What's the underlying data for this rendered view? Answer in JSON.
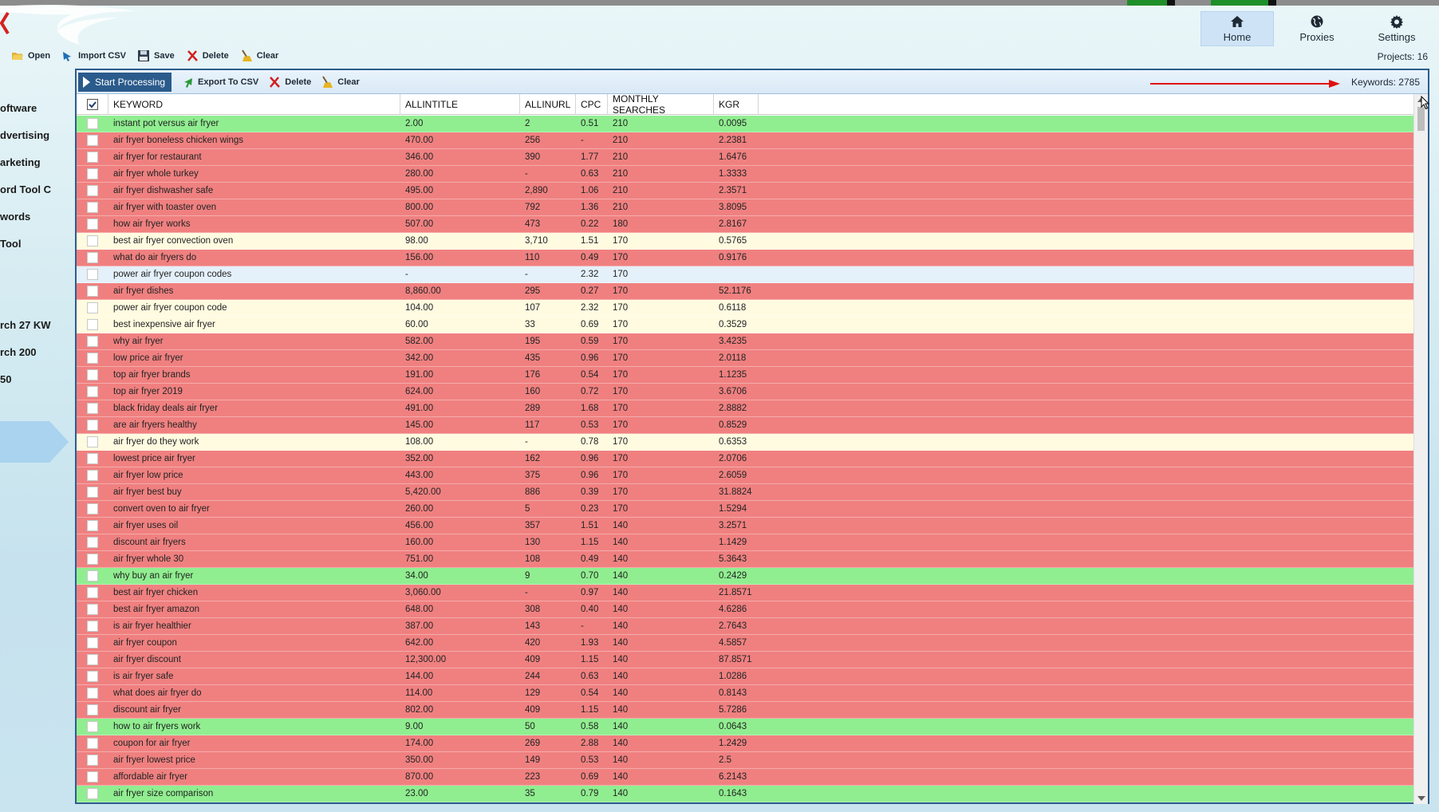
{
  "nav": {
    "home_label": "Home",
    "proxies_label": "Proxies",
    "settings_label": "Settings",
    "projects_text": "Projects: 16"
  },
  "toolbar": {
    "open_label": "Open",
    "import_label": "Import CSV",
    "save_label": "Save",
    "delete_label": "Delete",
    "clear_label": "Clear"
  },
  "sidebar": {
    "items": [
      "oftware",
      "dvertising",
      "arketing",
      "ord Tool C",
      "words",
      "Tool",
      "rch 27 KW",
      "rch 200",
      "50"
    ]
  },
  "panel": {
    "start_label": "Start Processing",
    "export_label": "Export To CSV",
    "delete_label": "Delete",
    "clear_label": "Clear",
    "keywords_text": "Keywords: 2785"
  },
  "table": {
    "columns": [
      "KEYWORD",
      "ALLINTITLE",
      "ALLINURL",
      "CPC",
      "MONTHLY SEARCHES",
      "KGR"
    ],
    "rows": [
      {
        "kw": "instant pot versus air fryer",
        "at": "2.00",
        "au": "2",
        "cpc": "0.51",
        "ms": "210",
        "kgr": "0.0095",
        "color": "green"
      },
      {
        "kw": "air fryer boneless chicken wings",
        "at": "470.00",
        "au": "256",
        "cpc": "-",
        "ms": "210",
        "kgr": "2.2381",
        "color": "red"
      },
      {
        "kw": "air fryer for restaurant",
        "at": "346.00",
        "au": "390",
        "cpc": "1.77",
        "ms": "210",
        "kgr": "1.6476",
        "color": "red"
      },
      {
        "kw": "air fryer whole turkey",
        "at": "280.00",
        "au": "-",
        "cpc": "0.63",
        "ms": "210",
        "kgr": "1.3333",
        "color": "red"
      },
      {
        "kw": "air fryer dishwasher safe",
        "at": "495.00",
        "au": "2,890",
        "cpc": "1.06",
        "ms": "210",
        "kgr": "2.3571",
        "color": "red"
      },
      {
        "kw": "air fryer with toaster oven",
        "at": "800.00",
        "au": "792",
        "cpc": "1.36",
        "ms": "210",
        "kgr": "3.8095",
        "color": "red"
      },
      {
        "kw": "how air fryer works",
        "at": "507.00",
        "au": "473",
        "cpc": "0.22",
        "ms": "180",
        "kgr": "2.8167",
        "color": "red"
      },
      {
        "kw": "best air fryer convection oven",
        "at": "98.00",
        "au": "3,710",
        "cpc": "1.51",
        "ms": "170",
        "kgr": "0.5765",
        "color": "yellow"
      },
      {
        "kw": "what do air fryers do",
        "at": "156.00",
        "au": "110",
        "cpc": "0.49",
        "ms": "170",
        "kgr": "0.9176",
        "color": "red"
      },
      {
        "kw": "power air fryer coupon codes",
        "at": "-",
        "au": "-",
        "cpc": "2.32",
        "ms": "170",
        "kgr": "",
        "color": "blue"
      },
      {
        "kw": "air fryer dishes",
        "at": "8,860.00",
        "au": "295",
        "cpc": "0.27",
        "ms": "170",
        "kgr": "52.1176",
        "color": "red"
      },
      {
        "kw": "power air fryer coupon code",
        "at": "104.00",
        "au": "107",
        "cpc": "2.32",
        "ms": "170",
        "kgr": "0.6118",
        "color": "yellow"
      },
      {
        "kw": "best inexpensive air fryer",
        "at": "60.00",
        "au": "33",
        "cpc": "0.69",
        "ms": "170",
        "kgr": "0.3529",
        "color": "yellow"
      },
      {
        "kw": "why air fryer",
        "at": "582.00",
        "au": "195",
        "cpc": "0.59",
        "ms": "170",
        "kgr": "3.4235",
        "color": "red"
      },
      {
        "kw": "low price air fryer",
        "at": "342.00",
        "au": "435",
        "cpc": "0.96",
        "ms": "170",
        "kgr": "2.0118",
        "color": "red"
      },
      {
        "kw": "top air fryer brands",
        "at": "191.00",
        "au": "176",
        "cpc": "0.54",
        "ms": "170",
        "kgr": "1.1235",
        "color": "red"
      },
      {
        "kw": "top air fryer 2019",
        "at": "624.00",
        "au": "160",
        "cpc": "0.72",
        "ms": "170",
        "kgr": "3.6706",
        "color": "red"
      },
      {
        "kw": "black friday deals air fryer",
        "at": "491.00",
        "au": "289",
        "cpc": "1.68",
        "ms": "170",
        "kgr": "2.8882",
        "color": "red"
      },
      {
        "kw": "are air fryers healthy",
        "at": "145.00",
        "au": "117",
        "cpc": "0.53",
        "ms": "170",
        "kgr": "0.8529",
        "color": "red"
      },
      {
        "kw": "air fryer do they work",
        "at": "108.00",
        "au": "-",
        "cpc": "0.78",
        "ms": "170",
        "kgr": "0.6353",
        "color": "yellow"
      },
      {
        "kw": "lowest price air fryer",
        "at": "352.00",
        "au": "162",
        "cpc": "0.96",
        "ms": "170",
        "kgr": "2.0706",
        "color": "red"
      },
      {
        "kw": "air fryer low price",
        "at": "443.00",
        "au": "375",
        "cpc": "0.96",
        "ms": "170",
        "kgr": "2.6059",
        "color": "red"
      },
      {
        "kw": "air fryer best buy",
        "at": "5,420.00",
        "au": "886",
        "cpc": "0.39",
        "ms": "170",
        "kgr": "31.8824",
        "color": "red"
      },
      {
        "kw": "convert oven to air fryer",
        "at": "260.00",
        "au": "5",
        "cpc": "0.23",
        "ms": "170",
        "kgr": "1.5294",
        "color": "red"
      },
      {
        "kw": "air fryer uses oil",
        "at": "456.00",
        "au": "357",
        "cpc": "1.51",
        "ms": "140",
        "kgr": "3.2571",
        "color": "red"
      },
      {
        "kw": "discount air fryers",
        "at": "160.00",
        "au": "130",
        "cpc": "1.15",
        "ms": "140",
        "kgr": "1.1429",
        "color": "red"
      },
      {
        "kw": "air fryer whole 30",
        "at": "751.00",
        "au": "108",
        "cpc": "0.49",
        "ms": "140",
        "kgr": "5.3643",
        "color": "red"
      },
      {
        "kw": "why buy an air fryer",
        "at": "34.00",
        "au": "9",
        "cpc": "0.70",
        "ms": "140",
        "kgr": "0.2429",
        "color": "green"
      },
      {
        "kw": "best air fryer chicken",
        "at": "3,060.00",
        "au": "-",
        "cpc": "0.97",
        "ms": "140",
        "kgr": "21.8571",
        "color": "red"
      },
      {
        "kw": "best air fryer amazon",
        "at": "648.00",
        "au": "308",
        "cpc": "0.40",
        "ms": "140",
        "kgr": "4.6286",
        "color": "red"
      },
      {
        "kw": "is air fryer healthier",
        "at": "387.00",
        "au": "143",
        "cpc": "-",
        "ms": "140",
        "kgr": "2.7643",
        "color": "red"
      },
      {
        "kw": "air fryer coupon",
        "at": "642.00",
        "au": "420",
        "cpc": "1.93",
        "ms": "140",
        "kgr": "4.5857",
        "color": "red"
      },
      {
        "kw": "air fryer discount",
        "at": "12,300.00",
        "au": "409",
        "cpc": "1.15",
        "ms": "140",
        "kgr": "87.8571",
        "color": "red"
      },
      {
        "kw": "is air fryer safe",
        "at": "144.00",
        "au": "244",
        "cpc": "0.63",
        "ms": "140",
        "kgr": "1.0286",
        "color": "red"
      },
      {
        "kw": "what does air fryer do",
        "at": "114.00",
        "au": "129",
        "cpc": "0.54",
        "ms": "140",
        "kgr": "0.8143",
        "color": "red"
      },
      {
        "kw": "discount air fryer",
        "at": "802.00",
        "au": "409",
        "cpc": "1.15",
        "ms": "140",
        "kgr": "5.7286",
        "color": "red"
      },
      {
        "kw": "how to air fryers work",
        "at": "9.00",
        "au": "50",
        "cpc": "0.58",
        "ms": "140",
        "kgr": "0.0643",
        "color": "green"
      },
      {
        "kw": "coupon for air fryer",
        "at": "174.00",
        "au": "269",
        "cpc": "2.88",
        "ms": "140",
        "kgr": "1.2429",
        "color": "red"
      },
      {
        "kw": "air fryer lowest price",
        "at": "350.00",
        "au": "149",
        "cpc": "0.53",
        "ms": "140",
        "kgr": "2.5",
        "color": "red"
      },
      {
        "kw": "affordable air fryer",
        "at": "870.00",
        "au": "223",
        "cpc": "0.69",
        "ms": "140",
        "kgr": "6.2143",
        "color": "red"
      },
      {
        "kw": "air fryer size comparison",
        "at": "23.00",
        "au": "35",
        "cpc": "0.79",
        "ms": "140",
        "kgr": "0.1643",
        "color": "green"
      }
    ]
  },
  "icons": {
    "home": "home-icon",
    "proxies": "globe-icon",
    "settings": "gear-icon"
  },
  "colors": {
    "red_row": "#f08080",
    "green_row": "#90ee90",
    "yellow_row": "#fffbe0",
    "blue_row": "#e4f0fa",
    "accent": "#2b5b8c"
  }
}
